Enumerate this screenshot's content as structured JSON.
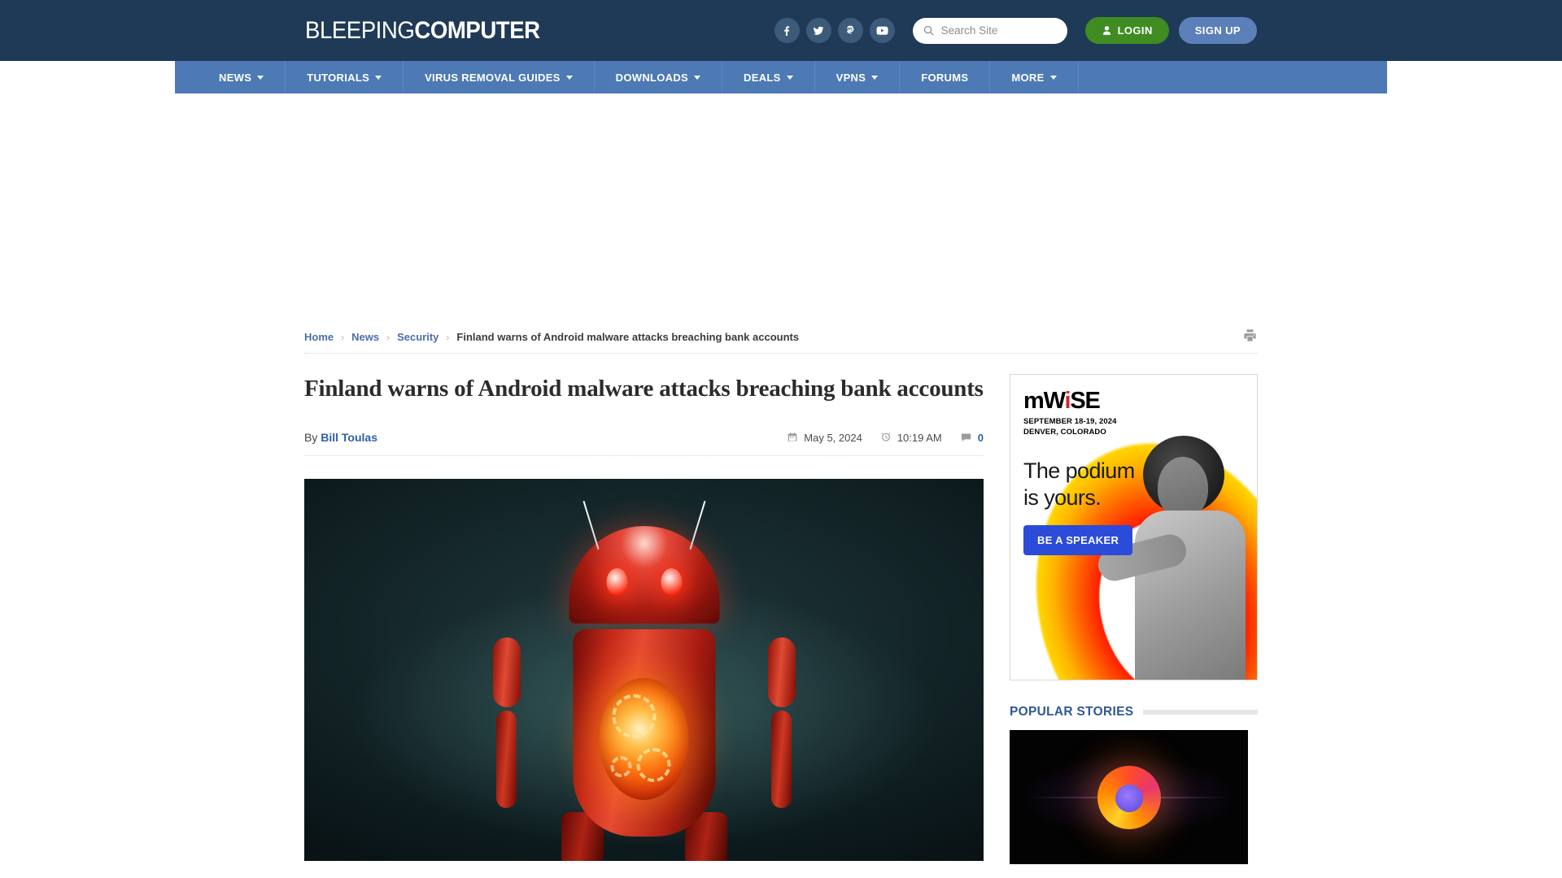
{
  "site": {
    "logo_light": "BLEEPING",
    "logo_bold": "COMPUTER"
  },
  "header": {
    "social": [
      {
        "name": "facebook-icon",
        "label": "Facebook"
      },
      {
        "name": "twitter-icon",
        "label": "Twitter"
      },
      {
        "name": "mastodon-icon",
        "label": "Mastodon"
      },
      {
        "name": "youtube-icon",
        "label": "YouTube"
      }
    ],
    "search": {
      "placeholder": "Search Site",
      "value": ""
    },
    "login_label": "LOGIN",
    "signup_label": "SIGN UP"
  },
  "nav": {
    "items": [
      {
        "label": "NEWS",
        "has_dropdown": true
      },
      {
        "label": "TUTORIALS",
        "has_dropdown": true
      },
      {
        "label": "VIRUS REMOVAL GUIDES",
        "has_dropdown": true
      },
      {
        "label": "DOWNLOADS",
        "has_dropdown": true
      },
      {
        "label": "DEALS",
        "has_dropdown": true
      },
      {
        "label": "VPNS",
        "has_dropdown": true
      },
      {
        "label": "FORUMS",
        "has_dropdown": false
      },
      {
        "label": "MORE",
        "has_dropdown": true
      }
    ]
  },
  "breadcrumb": {
    "items": [
      {
        "label": "Home",
        "current": false
      },
      {
        "label": "News",
        "current": false
      },
      {
        "label": "Security",
        "current": false
      },
      {
        "label": "Finland warns of Android malware attacks breaching bank accounts",
        "current": true
      }
    ],
    "separator": "›"
  },
  "article": {
    "headline": "Finland warns of Android malware attacks breaching bank accounts",
    "by_prefix": "By",
    "author": "Bill Toulas",
    "date": "May 5, 2024",
    "time": "10:19 AM",
    "comment_count": "0",
    "hero_image_alt": "Red Android robot with glowing eyes and illuminated gear core"
  },
  "sidebar": {
    "ad": {
      "brand": "mW",
      "brand_slash": "i",
      "brand_end": "SE",
      "date_line1": "SEPTEMBER 18-19, 2024",
      "date_line2": "DENVER, COLORADO",
      "headline_line1": "The podium",
      "headline_line2": "is yours.",
      "cta": "BE A SPEAKER"
    },
    "popular": {
      "title": "POPULAR STORIES",
      "stories": [
        {
          "thumb_alt": "Firefox logo on black background"
        }
      ]
    }
  },
  "colors": {
    "header_bg": "#1f3a56",
    "nav_bg": "#4d79b5",
    "login_green": "#3f8c22",
    "signup_blue": "#5b7fb9",
    "link_blue": "#2f5fa8",
    "popular_heading": "#2f5796",
    "ad_cta_blue": "#2b4bd8",
    "mwise_red": "#d8232a"
  }
}
